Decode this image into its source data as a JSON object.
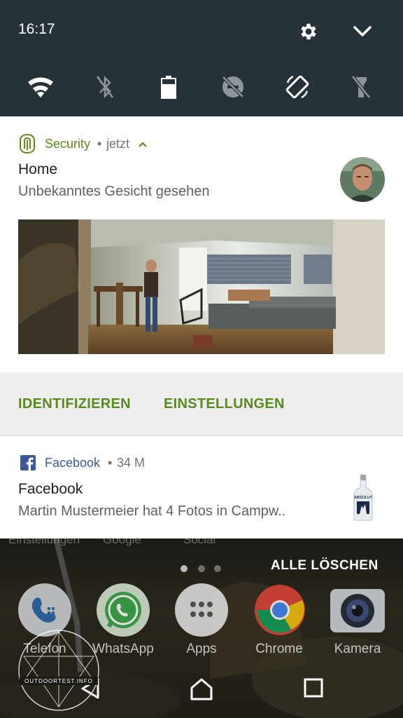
{
  "status_bar": {
    "time": "16:17",
    "icons": [
      "gear-icon",
      "chevron-down-icon"
    ]
  },
  "quick_settings": [
    "wifi-icon",
    "bluetooth-off-icon",
    "battery-icon",
    "do-not-disturb-icon",
    "auto-rotate-icon",
    "flashlight-off-icon"
  ],
  "security_notification": {
    "app_name": "Security",
    "separator": "•",
    "time": "jetzt",
    "title": "Home",
    "text": "Unbekanntes Gesicht gesehen",
    "actions": {
      "identify": "IDENTIFIZIEREN",
      "settings": "EINSTELLUNGEN"
    },
    "app_color": "#5a8a1e"
  },
  "facebook_notification": {
    "app_name": "Facebook",
    "separator": "•",
    "time": "34 M",
    "title": "Facebook",
    "text": "Martin Mustermeier hat 4 Fotos in Campw..",
    "bottle_brand": "ABSOLUT",
    "app_color": "#3b5998"
  },
  "home_screen": {
    "folder_labels": [
      "Einstellungen",
      "Google",
      "Social"
    ],
    "clear_all": "ALLE LÖSCHEN",
    "dock": [
      {
        "label": "Telefon",
        "icon": "phone-icon"
      },
      {
        "label": "WhatsApp",
        "icon": "whatsapp-icon"
      },
      {
        "label": "Apps",
        "icon": "apps-icon"
      },
      {
        "label": "Chrome",
        "icon": "chrome-icon"
      },
      {
        "label": "Kamera",
        "icon": "camera-icon"
      }
    ],
    "watermark_text": "OUTDOORTEST.INFO"
  },
  "nav_bar": [
    "back-icon",
    "home-icon",
    "recents-icon"
  ]
}
